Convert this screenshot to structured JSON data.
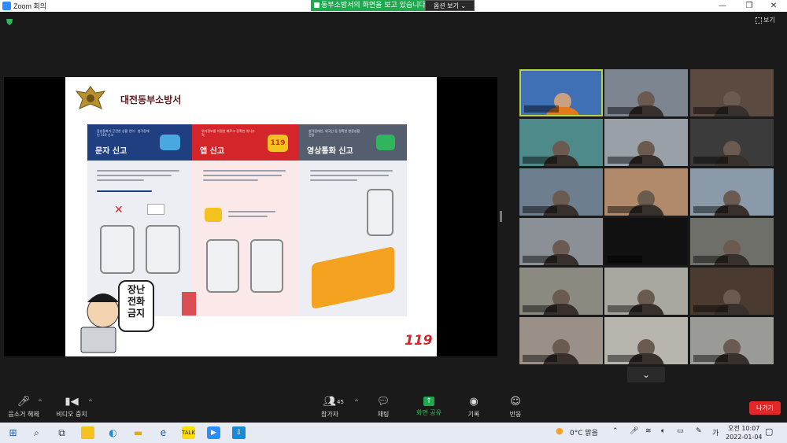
{
  "window": {
    "title": "Zoom 회의",
    "minimize": "—",
    "maximize": "❐",
    "close": "✕"
  },
  "share_banner": {
    "text": "동부소방서의 화면을 보고 있습니다",
    "options_label": "옵션 보기 ⌄"
  },
  "view_label": "보기",
  "slide": {
    "org_name": "대전동부소방서",
    "panels": [
      {
        "subtitle": "음성통화가 곤란한 상황 언어 · 청각장애인 119 신고",
        "name": "문자 신고",
        "color": "#1f3f80"
      },
      {
        "subtitle": "위치정보를 이용한 빠르고 정확한 위치추적",
        "name": "앱 신고",
        "color": "#d4262a"
      },
      {
        "subtitle": "청각장애인, 외국인 등 정확한 현장상황 전달",
        "name": "영상통화 신고",
        "color": "#555e6e"
      }
    ],
    "speech_bubble": [
      "장난",
      "전화",
      "금지"
    ],
    "logo": "119"
  },
  "toolbar": {
    "mute_label": "음소거 해제",
    "video_label": "비디오 중지",
    "participants_label": "참가자",
    "participants_count": "45",
    "chat_label": "채팅",
    "share_label": "화면 공유",
    "record_label": "기록",
    "reactions_label": "반응",
    "leave_label": "나가기"
  },
  "taskbar": {
    "weather": "0°C 맑음",
    "ime": "가",
    "time": "오전 10:07",
    "date": "2022-01-04"
  },
  "colors": {
    "active_speaker": "#b6d64a",
    "share_green": "#1fa84f",
    "leave_red": "#e02828"
  },
  "gallery": {
    "tile_count": 18
  }
}
